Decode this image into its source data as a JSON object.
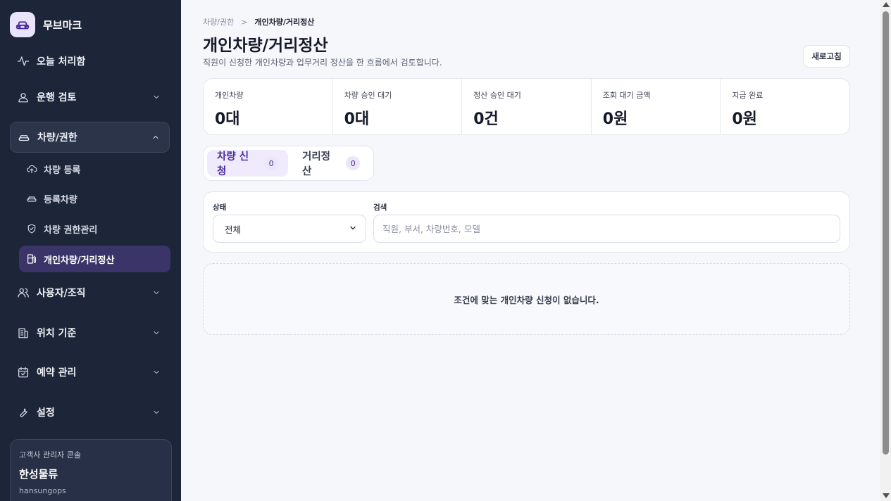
{
  "sidebar": {
    "brand": "무브마크",
    "today": "오늘 처리함",
    "groups": {
      "drive_review": "운행 검토",
      "vehicle_permission": "차량/권한",
      "user_org": "사용자/조직",
      "location": "위치 기준",
      "reservation": "예약 관리",
      "settings": "설정"
    },
    "sub_items": {
      "register": "차량 등록",
      "registered": "등록차량",
      "permission_mgmt": "차량 권한관리",
      "personal_settle": "개인차량/거리정산"
    },
    "console": {
      "label": "고객사 관리자 콘솔",
      "company": "한성물류",
      "account": "hansungops"
    }
  },
  "main": {
    "breadcrumb": {
      "parent": "차량/권한",
      "separator": ">",
      "current": "개인차량/거리정산"
    },
    "title": "개인차량/거리정산",
    "description": "직원이 신청한 개인차량과 업무거리 정산을 한 흐름에서 검토합니다.",
    "refresh_label": "새로고침",
    "stats": [
      {
        "label": "개인차량",
        "value": "0대"
      },
      {
        "label": "차량 승인 대기",
        "value": "0대"
      },
      {
        "label": "정산 승인 대기",
        "value": "0건"
      },
      {
        "label": "조회 대기 금액",
        "value": "0원"
      },
      {
        "label": "지급 완료",
        "value": "0원"
      }
    ],
    "tabs": [
      {
        "label": "차량 신청",
        "count": "0"
      },
      {
        "label": "거리정산",
        "count": "0"
      }
    ],
    "filter": {
      "status_label": "상태",
      "status_value": "전체",
      "search_label": "검색",
      "search_placeholder": "직원, 부서, 차량번호, 모델"
    },
    "empty_message": "조건에 맞는 개인차량 신청이 없습니다."
  },
  "colors": {
    "sidebar_bg": "#1d2538",
    "active_sub_bg": "#3b3468",
    "accent": "#4b2a9d",
    "tab_active_bg": "#f0ebfc"
  }
}
